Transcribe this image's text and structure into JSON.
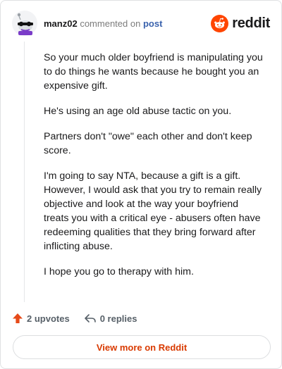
{
  "header": {
    "username": "manz02",
    "action_text": "commented on",
    "post_link": "post",
    "brand": "reddit"
  },
  "comment": {
    "paragraphs": [
      "So your much older boyfriend is manipulating you to do things he wants because he bought you an expensive gift.",
      "He's using an age old abuse tactic on you.",
      "Partners don't \"owe\" each other and don't keep score.",
      "I'm going to say NTA, because a gift is a gift. However, I would ask that you try to remain really objective and look at the way your boyfriend treats you with a critical eye - abusers often have redeeming qualities that they bring forward after inflicting abuse.",
      "I hope you go to therapy with him."
    ]
  },
  "actions": {
    "upvotes": "2 upvotes",
    "replies": "0 replies"
  },
  "footer": {
    "view_more": "View more on Reddit"
  },
  "colors": {
    "brand_orange": "#ff4500",
    "upvote": "#e64a19",
    "link_blue": "#3a62ad",
    "cta": "#d93a00"
  },
  "icons": [
    "avatar-icon",
    "reddit-logo-icon",
    "upvote-arrow-icon",
    "reply-arrow-icon"
  ]
}
